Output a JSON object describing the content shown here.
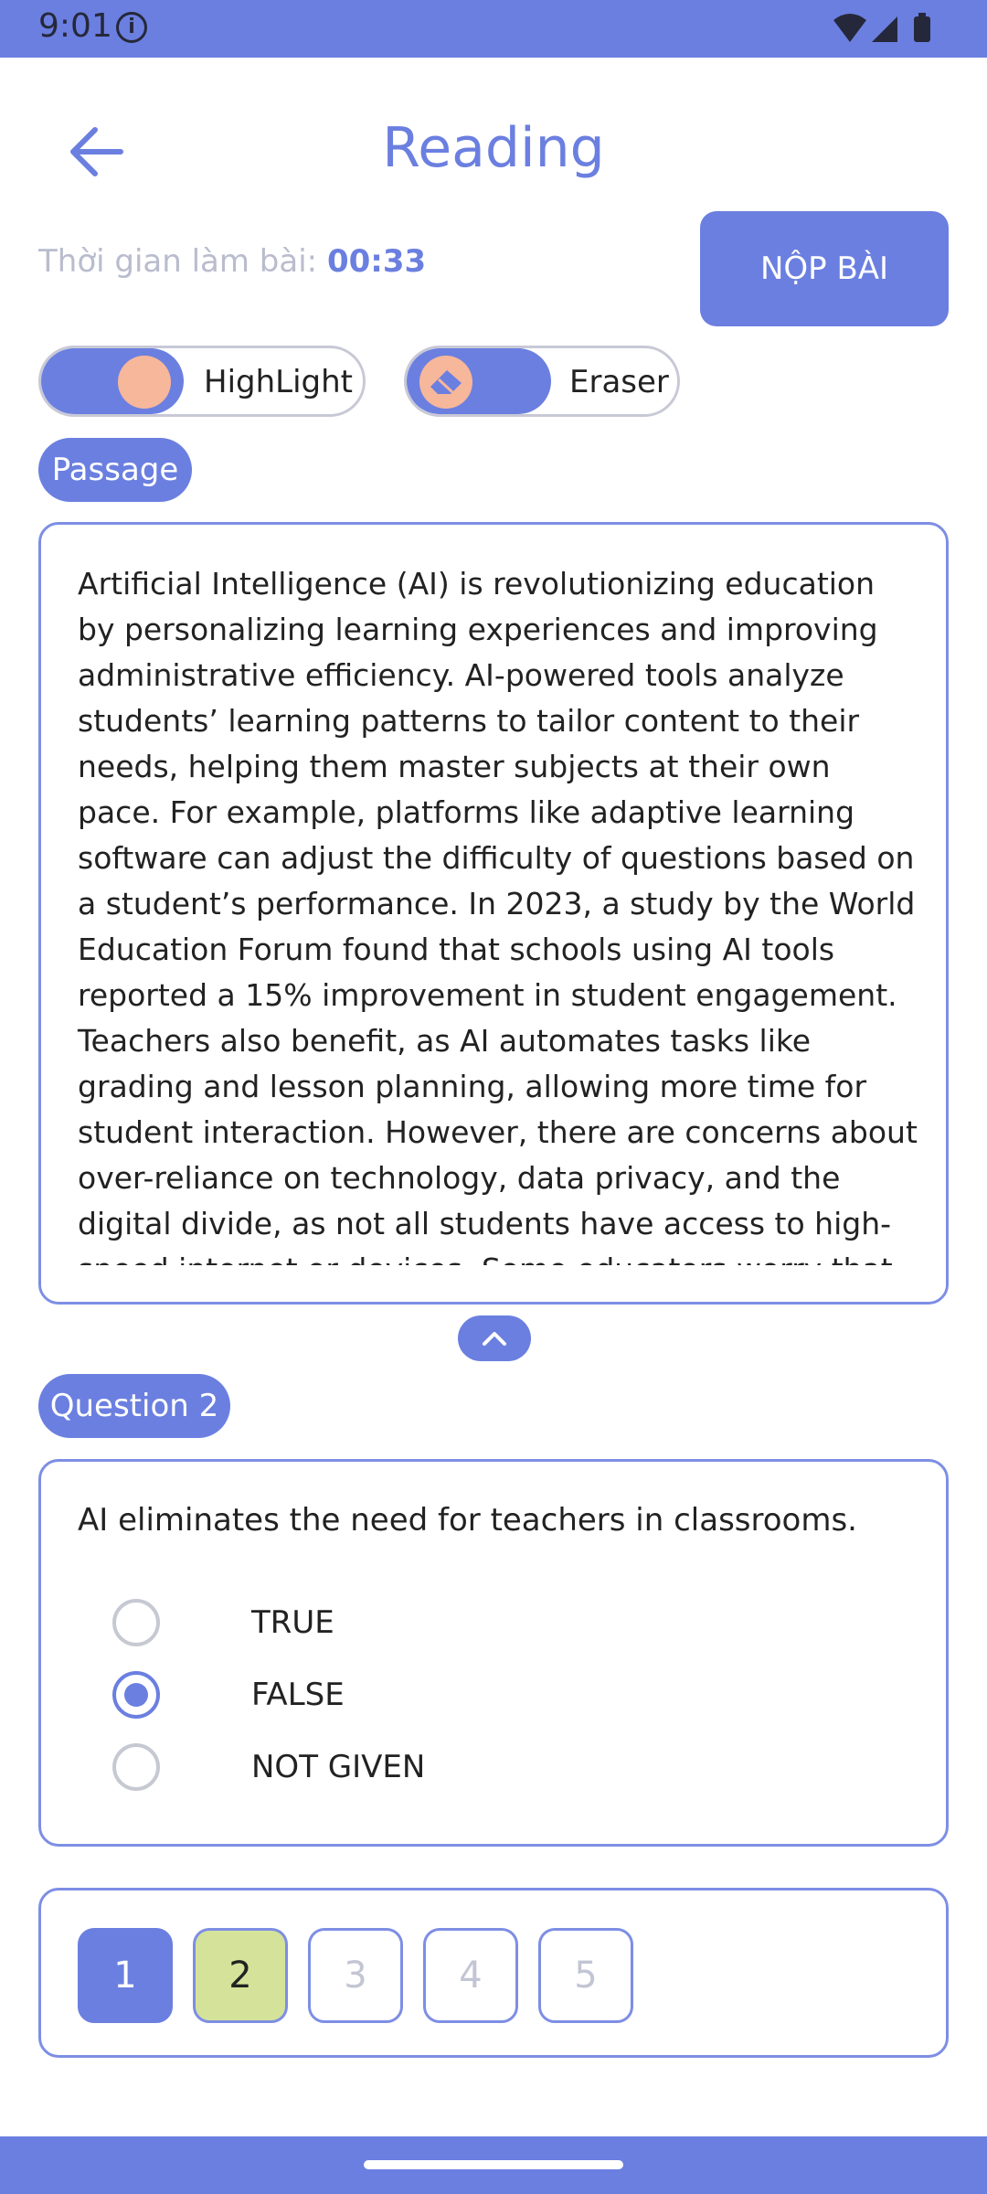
{
  "status_bar": {
    "time": "9:01",
    "info_glyph": "i",
    "icons": [
      "info-icon",
      "wifi-icon",
      "signal-icon",
      "battery-icon"
    ]
  },
  "header": {
    "title": "Reading",
    "back_icon": "arrow-left-icon"
  },
  "timer": {
    "label": "Thời gian làm bài:",
    "value": "00:33"
  },
  "submit": {
    "label": "NỘP BÀI"
  },
  "tools": {
    "highlight_label": "HighLight",
    "eraser_label": "Eraser"
  },
  "passage": {
    "badge": "Passage",
    "text": "Artificial Intelligence (AI) is revolutionizing education by personalizing learning experiences and improving administrative efficiency. AI-powered tools analyze students’ learning patterns to tailor content to their needs, helping them master subjects at their own pace. For example, platforms like adaptive learning software can adjust the difficulty of questions based on a student’s performance. In 2023, a study by the World Education Forum found that schools using AI tools reported a 15% improvement in student engagement. Teachers also benefit, as AI automates tasks like grading and lesson planning, allowing more time for student interaction. However, there are concerns about over-reliance on technology, data privacy, and the digital divide, as not all students have access to high-speed internet or devices. Some educators worry that AI might"
  },
  "question": {
    "badge": "Question 2",
    "text": "AI eliminates the need for teachers in classrooms.",
    "options": [
      {
        "label": "TRUE",
        "selected": false
      },
      {
        "label": "FALSE",
        "selected": true
      },
      {
        "label": "NOT GIVEN",
        "selected": false
      }
    ]
  },
  "navigator": {
    "items": [
      {
        "label": "1",
        "state": "current"
      },
      {
        "label": "2",
        "state": "answered"
      },
      {
        "label": "3",
        "state": "unanswered"
      },
      {
        "label": "4",
        "state": "unanswered"
      },
      {
        "label": "5",
        "state": "unanswered"
      }
    ]
  },
  "colors": {
    "accent": "#6b7fe0",
    "answered": "#d5e39a",
    "knob": "#f7b79a"
  }
}
